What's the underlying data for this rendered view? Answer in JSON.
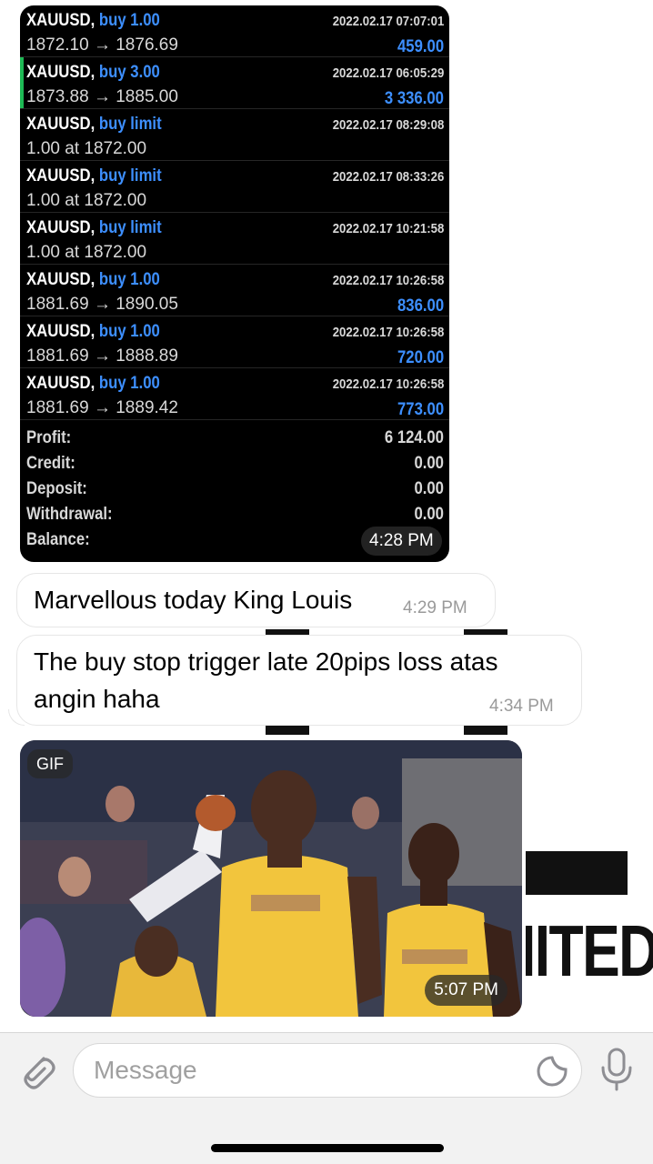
{
  "trades": [
    {
      "symbol": "XAUUSD,",
      "action": "buy 1.00",
      "date": "2022.02.17 07:07:01",
      "price": "1872.10 → 1876.69",
      "profit": "459.00",
      "marked": false
    },
    {
      "symbol": "XAUUSD,",
      "action": "buy 3.00",
      "date": "2022.02.17 06:05:29",
      "price": "1873.88 → 1885.00",
      "profit": "3 336.00",
      "marked": true
    },
    {
      "symbol": "XAUUSD,",
      "action": "buy limit",
      "date": "2022.02.17 08:29:08",
      "price": "1.00 at 1872.00",
      "profit": "",
      "marked": false
    },
    {
      "symbol": "XAUUSD,",
      "action": "buy limit",
      "date": "2022.02.17 08:33:26",
      "price": "1.00 at 1872.00",
      "profit": "",
      "marked": false
    },
    {
      "symbol": "XAUUSD,",
      "action": "buy limit",
      "date": "2022.02.17 10:21:58",
      "price": "1.00 at 1872.00",
      "profit": "",
      "marked": false
    },
    {
      "symbol": "XAUUSD,",
      "action": "buy 1.00",
      "date": "2022.02.17 10:26:58",
      "price": "1881.69 → 1890.05",
      "profit": "836.00",
      "marked": false
    },
    {
      "symbol": "XAUUSD,",
      "action": "buy 1.00",
      "date": "2022.02.17 10:26:58",
      "price": "1881.69 → 1888.89",
      "profit": "720.00",
      "marked": false
    },
    {
      "symbol": "XAUUSD,",
      "action": "buy 1.00",
      "date": "2022.02.17 10:26:58",
      "price": "1881.69 → 1889.42",
      "profit": "773.00",
      "marked": false
    }
  ],
  "summary": [
    {
      "label": "Profit:",
      "value": "6 124.00"
    },
    {
      "label": "Credit:",
      "value": "0.00"
    },
    {
      "label": "Deposit:",
      "value": "0.00"
    },
    {
      "label": "Withdrawal:",
      "value": "0.00"
    },
    {
      "label": "Balance:",
      "value": ""
    }
  ],
  "messages": {
    "image_time": "4:28 PM",
    "msg1_text": "Marvellous today King Louis",
    "msg1_time": "4:29 PM",
    "msg2_line1": "The buy stop trigger late 20pips loss atas",
    "msg2_line2": "angin haha",
    "msg2_time": "4:34 PM",
    "gif_badge": "GIF",
    "gif_time": "5:07 PM"
  },
  "background": {
    "partial_text": "IITED"
  },
  "input": {
    "placeholder": "Message"
  },
  "colors": {
    "accent_blue": "#3d8fff",
    "marker_green": "#1db954"
  }
}
